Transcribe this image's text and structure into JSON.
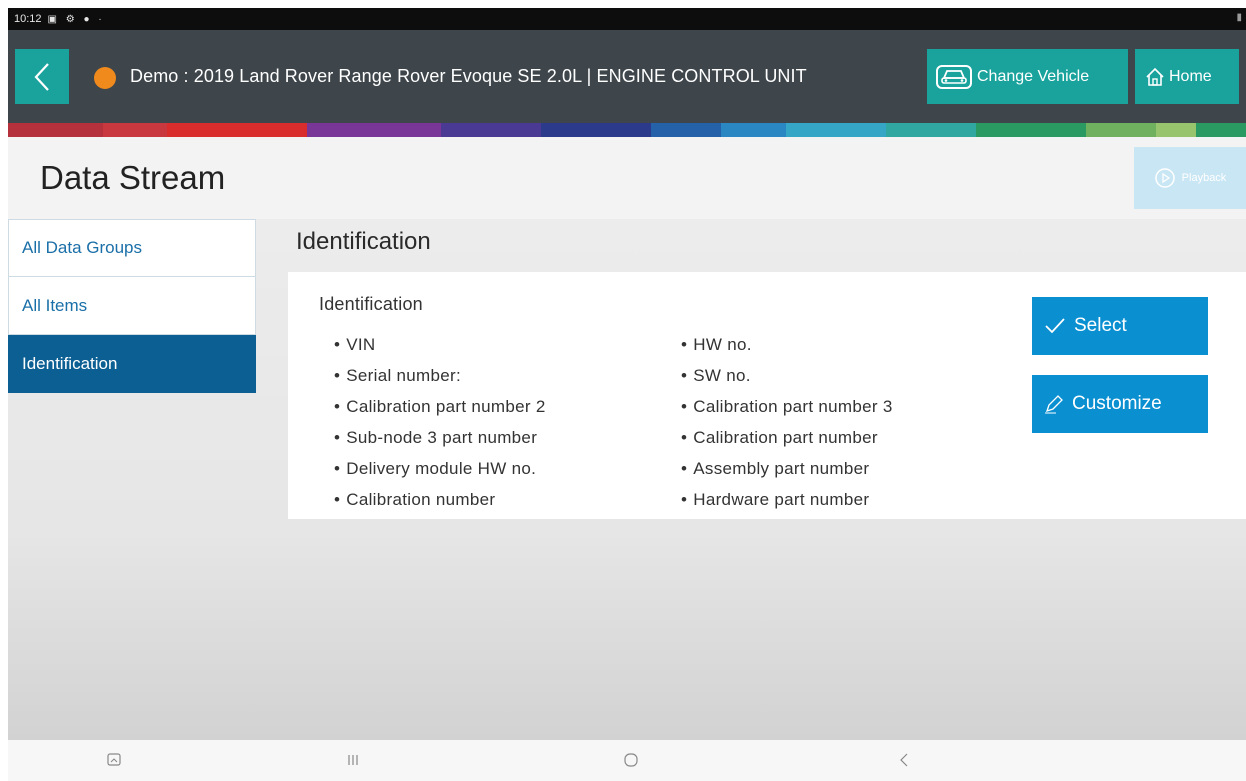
{
  "status_bar": {
    "time": "10:12",
    "icons": "▣ ⚙ ● ·"
  },
  "header": {
    "title": "Demo : 2019 Land Rover Range Rover Evoque SE 2.0L | ENGINE CONTROL UNIT",
    "status_color": "#f08a1c",
    "change_vehicle_label": "Change Vehicle",
    "home_label": "Home",
    "icons": {
      "back": "chevron-left-icon",
      "change_vehicle": "car-icon",
      "home": "home-icon"
    }
  },
  "stripe_colors": [
    "#b5323c",
    "#c8383e",
    "#d92d2d",
    "#7a3696",
    "#4a3a93",
    "#2c3a8c",
    "#2561a8",
    "#2a87c2",
    "#36a6c6",
    "#31a7a2",
    "#2a9a62",
    "#6fb15e",
    "#98c46e",
    "#2a9a62"
  ],
  "page": {
    "title": "Data Stream",
    "playback_label": "Playback"
  },
  "sidebar": {
    "items": [
      {
        "label": "All Data Groups",
        "active": false
      },
      {
        "label": "All Items",
        "active": false
      },
      {
        "label": "Identification",
        "active": true
      }
    ]
  },
  "main": {
    "section_title": "Identification",
    "card": {
      "title": "Identification",
      "column_1": [
        "VIN",
        "Serial number:",
        "Calibration part number 2",
        "Sub-node 3 part number",
        "Delivery module HW no.",
        "Calibration number"
      ],
      "column_2": [
        "HW no.",
        "SW no.",
        "Calibration part number 3",
        "Calibration part number",
        "Assembly part number",
        "Hardware part number"
      ]
    },
    "select_label": "Select",
    "customize_label": "Customize"
  },
  "colors": {
    "accent_teal": "#1aa39d",
    "header_bg": "#3e464c",
    "active_blue": "#0c5f93",
    "button_blue": "#0a8fd1"
  },
  "nav_bar": {
    "icons": [
      "recent-screenshot-icon",
      "recents-icon",
      "home-circle-icon",
      "back-icon"
    ]
  }
}
